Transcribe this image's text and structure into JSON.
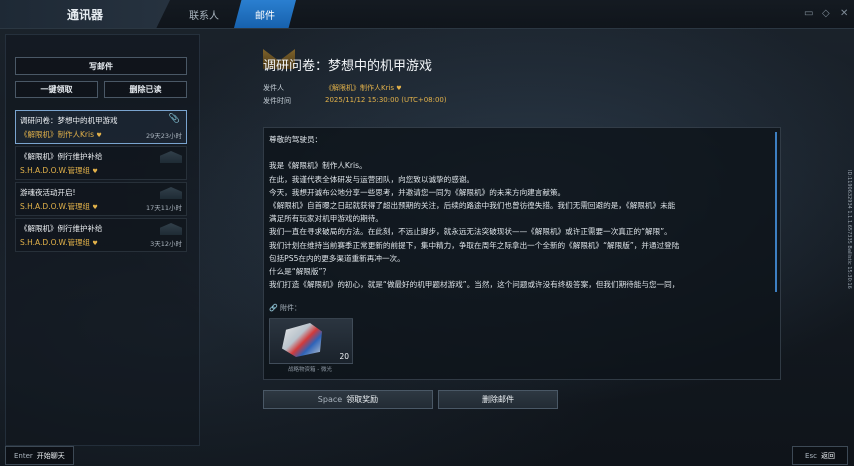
{
  "topbar": {
    "title": "通讯器",
    "tabs": [
      {
        "label": "联系人"
      },
      {
        "label": "邮件"
      }
    ]
  },
  "sidebar": {
    "write_button": "写邮件",
    "claim_all_button": "一键领取",
    "delete_read_button": "删除已读",
    "mails": [
      {
        "title": "调研问卷：梦想中的机甲游戏",
        "sender": "《解限机》制作人Kris",
        "time": "29天23小时",
        "selected": true,
        "has_attachment": true
      },
      {
        "title": "《解限机》例行维护补给",
        "sender": "S.H.A.D.O.W.管理组",
        "time": "",
        "selected": false,
        "has_attachment": false
      },
      {
        "title": "游魂夜活动开启!",
        "sender": "S.H.A.D.O.W.管理组",
        "time": "17天11小时",
        "selected": false,
        "has_attachment": false
      },
      {
        "title": "《解限机》例行维护补给",
        "sender": "S.H.A.D.O.W.管理组",
        "time": "3天12小时",
        "selected": false,
        "has_attachment": false
      }
    ]
  },
  "mail": {
    "title": "调研问卷：梦想中的机甲游戏",
    "sender_label": "发件人",
    "sender": "《解限机》制作人Kris",
    "time_label": "发件时间",
    "time": "2025/11/12  15:30:00 (UTC+08:00)",
    "body": [
      "尊敬的驾驶员：",
      "",
      "我是《解限机》制作人Kris。",
      "在此，我谨代表全体研发与运营团队，向您致以诚挚的感谢。",
      "今天，我想开诚布公地分享一些思考，并邀请您一同为《解限机》的未来方向建言献策。",
      "《解限机》自首曝之日起就获得了超出预期的关注，后续的路途中我们也曾彷徨失措。我们无需回避的是，《解限机》未能",
      "满足所有玩家对机甲游戏的期待。",
      "我们一直在寻求破局的方法。在此刻，不远止脚步，就永远无法突破现状——《解限机》或许正需要一次真正的“解限”。",
      "我们计划在维持当前赛季正常更新的前提下，集中精力，争取在周年之际拿出一个全新的《解限机》“解限版”，并通过登陆",
      "包括PS5在内的更多渠道重新再冲一次。",
      "什么是“解限版”？",
      "我们打造《解限机》的初心，就是“做最好的机甲题材游戏”。当然，这个问题或许没有终极答案，但我们期待能与您一同，"
    ],
    "attachment_label": "附件：",
    "attachment": {
      "name": "战略物资箱 - 微光",
      "count": "20"
    }
  },
  "actions": {
    "claim_key": "Space",
    "claim_label": "领取奖励",
    "delete_label": "删除邮件"
  },
  "footer": {
    "chat_key": "Enter",
    "chat_label": "开始聊天",
    "back_key": "Esc",
    "back_label": "返回"
  },
  "side_info": "ID:1190632934  1.1.1.657335  Ballistic  15:30:16",
  "colors": {
    "accent": "#2a7fd0",
    "gold": "#e3b24a"
  }
}
